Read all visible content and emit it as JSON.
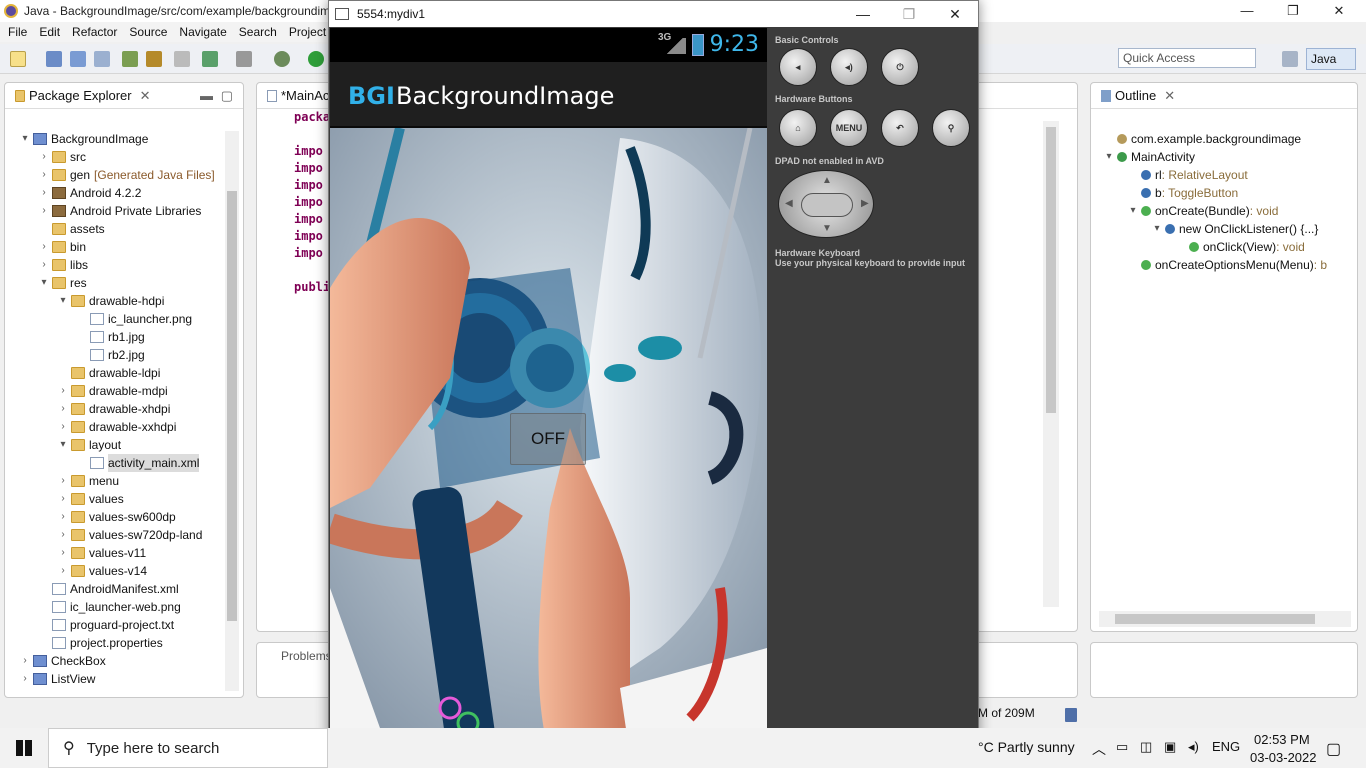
{
  "window": {
    "title": "Java - BackgroundImage/src/com/example/backgroundim",
    "minimize": "—",
    "maximize": "❐",
    "close": "✕"
  },
  "menu": [
    "File",
    "Edit",
    "Refactor",
    "Source",
    "Navigate",
    "Search",
    "Project"
  ],
  "quick_access": {
    "placeholder": "Quick Access"
  },
  "perspective": "Java",
  "package_explorer": {
    "title": "Package Explorer",
    "items": [
      {
        "label": "BackgroundImage",
        "depth": 0,
        "icon": "project-icon",
        "twist": "▾"
      },
      {
        "label": "src",
        "depth": 1,
        "icon": "package-folder-icon",
        "twist": "›"
      },
      {
        "label": "gen",
        "suffix": "[Generated Java Files]",
        "depth": 1,
        "icon": "package-folder-icon",
        "twist": "›"
      },
      {
        "label": "Android 4.2.2",
        "depth": 1,
        "icon": "library-icon",
        "twist": "›"
      },
      {
        "label": "Android Private Libraries",
        "depth": 1,
        "icon": "library-icon",
        "twist": "›"
      },
      {
        "label": "assets",
        "depth": 1,
        "icon": "folder-icon",
        "twist": ""
      },
      {
        "label": "bin",
        "depth": 1,
        "icon": "folder-icon",
        "twist": "›"
      },
      {
        "label": "libs",
        "depth": 1,
        "icon": "folder-icon",
        "twist": "›"
      },
      {
        "label": "res",
        "depth": 1,
        "icon": "folder-icon",
        "twist": "▾"
      },
      {
        "label": "drawable-hdpi",
        "depth": 2,
        "icon": "folder-icon",
        "twist": "▾"
      },
      {
        "label": "ic_launcher.png",
        "depth": 3,
        "icon": "file-icon",
        "twist": ""
      },
      {
        "label": "rb1.jpg",
        "depth": 3,
        "icon": "file-icon",
        "twist": ""
      },
      {
        "label": "rb2.jpg",
        "depth": 3,
        "icon": "file-icon",
        "twist": ""
      },
      {
        "label": "drawable-ldpi",
        "depth": 2,
        "icon": "folder-icon",
        "twist": ""
      },
      {
        "label": "drawable-mdpi",
        "depth": 2,
        "icon": "folder-icon",
        "twist": "›"
      },
      {
        "label": "drawable-xhdpi",
        "depth": 2,
        "icon": "folder-icon",
        "twist": "›"
      },
      {
        "label": "drawable-xxhdpi",
        "depth": 2,
        "icon": "folder-icon",
        "twist": "›"
      },
      {
        "label": "layout",
        "depth": 2,
        "icon": "folder-icon",
        "twist": "▾"
      },
      {
        "label": "activity_main.xml",
        "depth": 3,
        "icon": "file-icon",
        "twist": "",
        "selected": true
      },
      {
        "label": "menu",
        "depth": 2,
        "icon": "folder-icon",
        "twist": "›"
      },
      {
        "label": "values",
        "depth": 2,
        "icon": "folder-icon",
        "twist": "›"
      },
      {
        "label": "values-sw600dp",
        "depth": 2,
        "icon": "folder-icon",
        "twist": "›"
      },
      {
        "label": "values-sw720dp-land",
        "depth": 2,
        "icon": "folder-icon",
        "twist": "›"
      },
      {
        "label": "values-v11",
        "depth": 2,
        "icon": "folder-icon",
        "twist": "›"
      },
      {
        "label": "values-v14",
        "depth": 2,
        "icon": "folder-icon",
        "twist": "›"
      },
      {
        "label": "AndroidManifest.xml",
        "depth": 1,
        "icon": "file-icon",
        "twist": ""
      },
      {
        "label": "ic_launcher-web.png",
        "depth": 1,
        "icon": "file-icon",
        "twist": ""
      },
      {
        "label": "proguard-project.txt",
        "depth": 1,
        "icon": "file-icon",
        "twist": ""
      },
      {
        "label": "project.properties",
        "depth": 1,
        "icon": "file-icon",
        "twist": ""
      },
      {
        "label": "CheckBox",
        "depth": 0,
        "icon": "project-icon",
        "twist": "›"
      },
      {
        "label": "ListView",
        "depth": 0,
        "icon": "project-icon",
        "twist": "›"
      }
    ]
  },
  "editor": {
    "tab": "*MainActivi",
    "lines": [
      "packa",
      "",
      "impo",
      "impo",
      "impo",
      "impo",
      "impo",
      "impo",
      "impo",
      "",
      "publi"
    ]
  },
  "problems_tab": "Problems",
  "outline": {
    "title": "Outline",
    "items": [
      {
        "label": "com.example.backgroundimage",
        "type": "",
        "depth": 0,
        "twist": ""
      },
      {
        "label": "MainActivity",
        "type": "",
        "depth": 0,
        "twist": "▾"
      },
      {
        "label": "rl",
        "type": " : RelativeLayout",
        "depth": 1,
        "twist": ""
      },
      {
        "label": "b",
        "type": " : ToggleButton",
        "depth": 1,
        "twist": ""
      },
      {
        "label": "onCreate(Bundle)",
        "type": " : void",
        "depth": 1,
        "twist": "▾"
      },
      {
        "label": "new OnClickListener() {...}",
        "type": "",
        "depth": 2,
        "twist": "▾"
      },
      {
        "label": "onClick(View)",
        "type": " : void",
        "depth": 3,
        "twist": ""
      },
      {
        "label": "onCreateOptionsMenu(Menu)",
        "type": " : b",
        "depth": 1,
        "twist": ""
      }
    ]
  },
  "heap": "M of 209M",
  "emulator": {
    "title": "5554:mydiv1",
    "network": "3G",
    "clock": "9:23",
    "app_badge": "BGI",
    "app_title": "BackgroundImage",
    "toggle_label": "OFF",
    "basic_controls": "Basic Controls",
    "hardware_buttons": "Hardware Buttons",
    "menu_button": "MENU",
    "dpad_note": "DPAD not enabled in AVD",
    "keyboard_title": "Hardware Keyboard",
    "keyboard_note": "Use your physical keyboard to provide input"
  },
  "taskbar": {
    "search_placeholder": "Type here to search",
    "weather": "°C  Partly sunny",
    "lang": "ENG",
    "time": "02:53 PM",
    "date": "03-03-2022"
  },
  "colors": {
    "accent": "#31b0e8",
    "emulator_bg": "#3c3c3c"
  }
}
